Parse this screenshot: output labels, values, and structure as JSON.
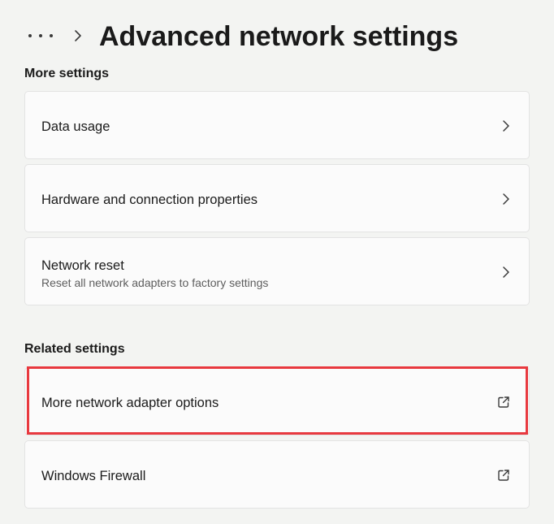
{
  "header": {
    "more_icon": "more-horizontal-icon",
    "chevron_icon": "chevron-right-icon",
    "title": "Advanced network settings"
  },
  "sections": {
    "more_settings": {
      "heading": "More settings",
      "items": [
        {
          "title": "Data usage",
          "icon": "chevron-right-icon"
        },
        {
          "title": "Hardware and connection properties",
          "icon": "chevron-right-icon"
        },
        {
          "title": "Network reset",
          "subtitle": "Reset all network adapters to factory settings",
          "icon": "chevron-right-icon"
        }
      ]
    },
    "related_settings": {
      "heading": "Related settings",
      "items": [
        {
          "title": "More network adapter options",
          "icon": "open-external-icon",
          "highlighted": true
        },
        {
          "title": "Windows Firewall",
          "icon": "open-external-icon"
        }
      ]
    }
  },
  "colors": {
    "background": "#f3f4f2",
    "card": "#fbfbfb",
    "highlight": "#e8393f"
  }
}
